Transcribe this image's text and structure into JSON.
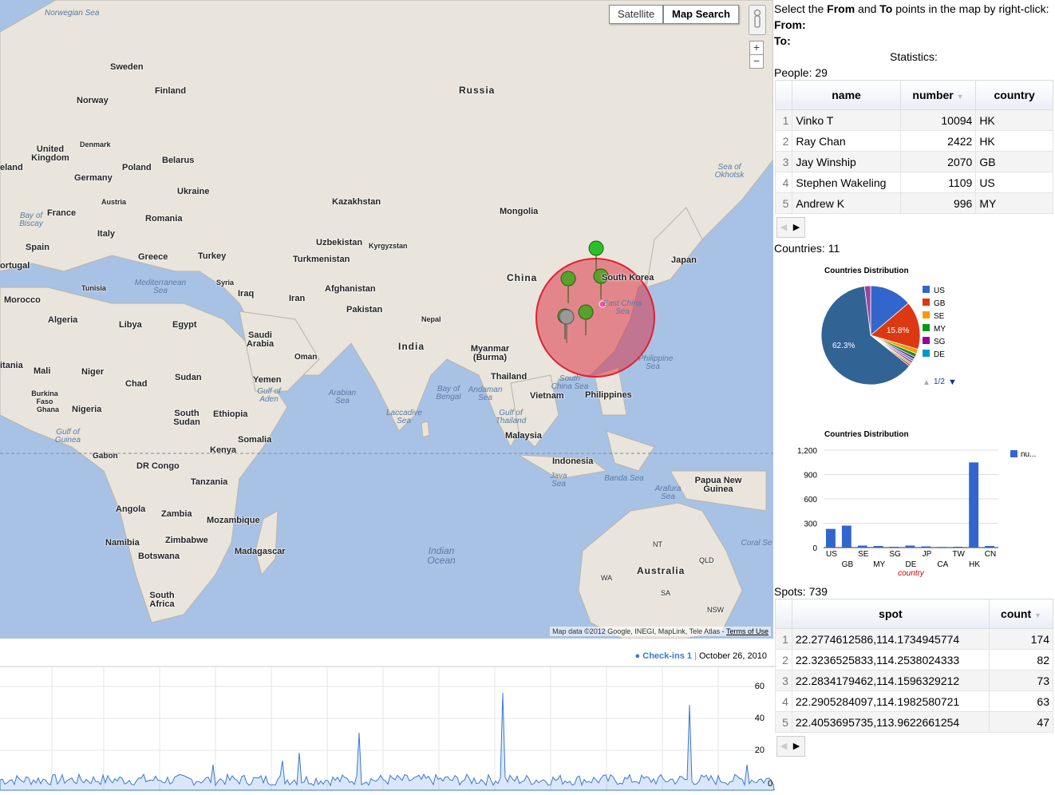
{
  "map": {
    "type_buttons": {
      "satellite": "Satellite",
      "map_search": "Map Search"
    },
    "zoom": {
      "in": "+",
      "out": "−"
    },
    "attribution": "Map data ©2012 Google, INEGI, MapLink, Tele Atlas - ",
    "terms": "Terms of Use",
    "labels": {
      "norwegian_sea": "Norwegian Sea",
      "sweden": "Sweden",
      "finland": "Finland",
      "norway": "Norway",
      "russia": "Russia",
      "denmark": "Denmark",
      "united_kingdom": "United Kingdom",
      "ireland": "eland",
      "poland": "Poland",
      "belarus": "Belarus",
      "germany": "Germany",
      "ukraine": "Ukraine",
      "austria": "Austria",
      "bay_of_biscay": "Bay of Biscay",
      "france": "France",
      "romania": "Romania",
      "kazakhstan": "Kazakhstan",
      "mongolia": "Mongolia",
      "sea_of_okhotsk": "Sea of Okhotsk",
      "italy": "Italy",
      "spain": "Spain",
      "portugal": "ortugal",
      "greece": "Greece",
      "turkey": "Turkey",
      "uzbekistan": "Uzbekistan",
      "kyrgyzstan": "Kyrgyzstan",
      "turkmenistan": "Turkmenistan",
      "china": "China",
      "japan": "Japan",
      "south_korea": "South Korea",
      "tunisia": "Tunisia",
      "mediterranean_sea": "Mediterranean Sea",
      "syria": "Syria",
      "afghanistan": "Afghanistan",
      "morocco": "Morocco",
      "iraq": "Iraq",
      "iran": "Iran",
      "pakistan": "Pakistan",
      "nepal": "Nepal",
      "east_china_sea": "East China Sea",
      "algeria": "Algeria",
      "libya": "Libya",
      "egypt": "Egypt",
      "saudi_arabia": "Saudi Arabia",
      "india": "India",
      "myanmar": "Myanmar (Burma)",
      "oman": "Oman",
      "mauritania": "itania",
      "mali": "Mali",
      "niger": "Niger",
      "sudan": "Sudan",
      "chad": "Chad",
      "yemen": "Yemen",
      "gulf_of_aden": "Gulf of Aden",
      "thailand": "Thailand",
      "philippine_sea": "Philippine Sea",
      "arabian_sea": "Arabian Sea",
      "bay_of_bengal": "Bay of Bengal",
      "andaman_sea": "Andaman Sea",
      "south_china_sea": "South China Sea",
      "vietnam": "Vietnam",
      "philippines": "Philippines",
      "burkina_faso": "Burkina Faso",
      "ghana": "Ghana",
      "nigeria": "Nigeria",
      "south_sudan": "South Sudan",
      "ethiopia": "Ethiopia",
      "laccadive_sea": "Laccadive Sea",
      "gulf_of_thailand": "Gulf of Thailand",
      "malaysia": "Malaysia",
      "gulf_of_guinea": "Gulf of Guinea",
      "somalia": "Somalia",
      "gabon": "Gabon",
      "kenya": "Kenya",
      "indonesia": "Indonesia",
      "dr_congo": "DR Congo",
      "tanzania": "Tanzania",
      "java_sea": "Java Sea",
      "banda_sea": "Banda Sea",
      "papua_new_guinea": "Papua New Guinea",
      "arafura_sea": "Arafura Sea",
      "angola": "Angola",
      "zambia": "Zambia",
      "mozambique": "Mozambique",
      "namibia": "Namibia",
      "zimbabwe": "Zimbabwe",
      "botswana": "Botswana",
      "madagascar": "Madagascar",
      "indian_ocean": "Indian Ocean",
      "nt": "NT",
      "qld": "QLD",
      "wa": "WA",
      "australia": "Australia",
      "coral_sea": "Coral Se",
      "sa": "SA",
      "nsw": "NSW",
      "south_africa": "South Africa"
    }
  },
  "timeline": {
    "series_name": "Check-ins 1",
    "date": "October 26, 2010",
    "y_ticks": [
      "60",
      "40",
      "20",
      "0"
    ],
    "color": "#3a78d6"
  },
  "panel": {
    "instruction": {
      "pre": "Select the ",
      "from": "From",
      "mid": " and ",
      "to": "To",
      "post": " points in the map by right-click:"
    },
    "from_label": "From",
    "to_label": "To",
    "statistics": "Statistics:",
    "people_label": "People: 29",
    "people_table": {
      "headers": [
        "name",
        "number",
        "country"
      ],
      "rows": [
        {
          "i": "1",
          "name": "Vinko T",
          "number": "10094",
          "country": "HK"
        },
        {
          "i": "2",
          "name": "Ray Chan",
          "number": "2422",
          "country": "HK"
        },
        {
          "i": "3",
          "name": "Jay Winship",
          "number": "2070",
          "country": "GB"
        },
        {
          "i": "4",
          "name": "Stephen Wakeling",
          "number": "1109",
          "country": "US"
        },
        {
          "i": "5",
          "name": "Andrew K",
          "number": "996",
          "country": "MY"
        }
      ]
    },
    "countries_label": "Countries: 11",
    "spots_label": "Spots: 739",
    "spots_table": {
      "headers": [
        "spot",
        "count"
      ],
      "rows": [
        {
          "i": "1",
          "spot": "22.2774612586,114.1734945774",
          "count": "174"
        },
        {
          "i": "2",
          "spot": "22.3236525833,114.2538024333",
          "count": "82"
        },
        {
          "i": "3",
          "spot": "22.2834179462,114.1596329212",
          "count": "73"
        },
        {
          "i": "4",
          "spot": "22.2905284097,114.1982580721",
          "count": "63"
        },
        {
          "i": "5",
          "spot": "22.4053695735,113.9622661254",
          "count": "47"
        }
      ]
    }
  },
  "chart_data": [
    {
      "type": "pie",
      "title": "Countries Distribution",
      "legend": [
        "US",
        "GB",
        "SE",
        "MY",
        "SG",
        "DE"
      ],
      "slice_labels": {
        "hk": "62.3%",
        "gb": "15.8%"
      },
      "slices": [
        {
          "name": "US",
          "value": 13.8,
          "color": "#3366cc"
        },
        {
          "name": "GB",
          "value": 15.8,
          "color": "#dc3912"
        },
        {
          "name": "SE",
          "value": 1.5,
          "color": "#ff9900"
        },
        {
          "name": "MY",
          "value": 1.2,
          "color": "#109618"
        },
        {
          "name": "SG",
          "value": 0.8,
          "color": "#990099"
        },
        {
          "name": "DE",
          "value": 0.7,
          "color": "#0099c6"
        },
        {
          "name": "JP",
          "value": 0.8,
          "color": "#dd4477"
        },
        {
          "name": "CA",
          "value": 0.5,
          "color": "#66aa00"
        },
        {
          "name": "TW",
          "value": 0.6,
          "color": "#b82e2e"
        },
        {
          "name": "HK",
          "value": 62.3,
          "color": "#316395"
        },
        {
          "name": "CN",
          "value": 2.0,
          "color": "#994499"
        }
      ],
      "pager": "1/2",
      "legend_position": "right"
    },
    {
      "type": "bar",
      "title": "Countries Distribution",
      "categories": [
        "US",
        "GB",
        "SE",
        "MY",
        "SG",
        "DE",
        "JP",
        "CA",
        "TW",
        "HK",
        "CN"
      ],
      "series": [
        {
          "name": "nu...",
          "values": [
            230,
            270,
            25,
            20,
            10,
            25,
            15,
            8,
            10,
            1050,
            20
          ]
        }
      ],
      "xlabel": "country",
      "y_ticks": [
        "1,200",
        "900",
        "600",
        "300",
        "0"
      ],
      "ylim": [
        0,
        1200
      ],
      "color": "#3366cc",
      "legend_position": "right"
    }
  ]
}
